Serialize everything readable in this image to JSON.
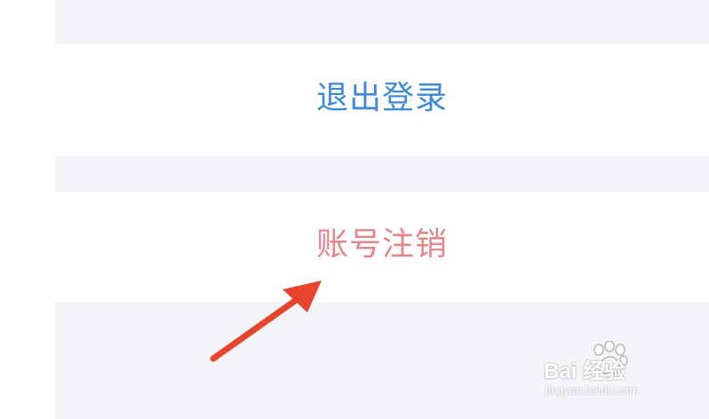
{
  "actions": {
    "logout_label": "退出登录",
    "deactivate_label": "账号注销"
  },
  "watermark": {
    "brand": "Bai  经验",
    "url": "jingyan.baidu.com"
  },
  "colors": {
    "logout": "#3d8ad6",
    "deactivate": "#e4878a",
    "background": "#f4f5f9",
    "arrow": "#e8452c"
  },
  "icons": {
    "pointer": "red-arrow-icon",
    "watermark": "paw-icon"
  }
}
